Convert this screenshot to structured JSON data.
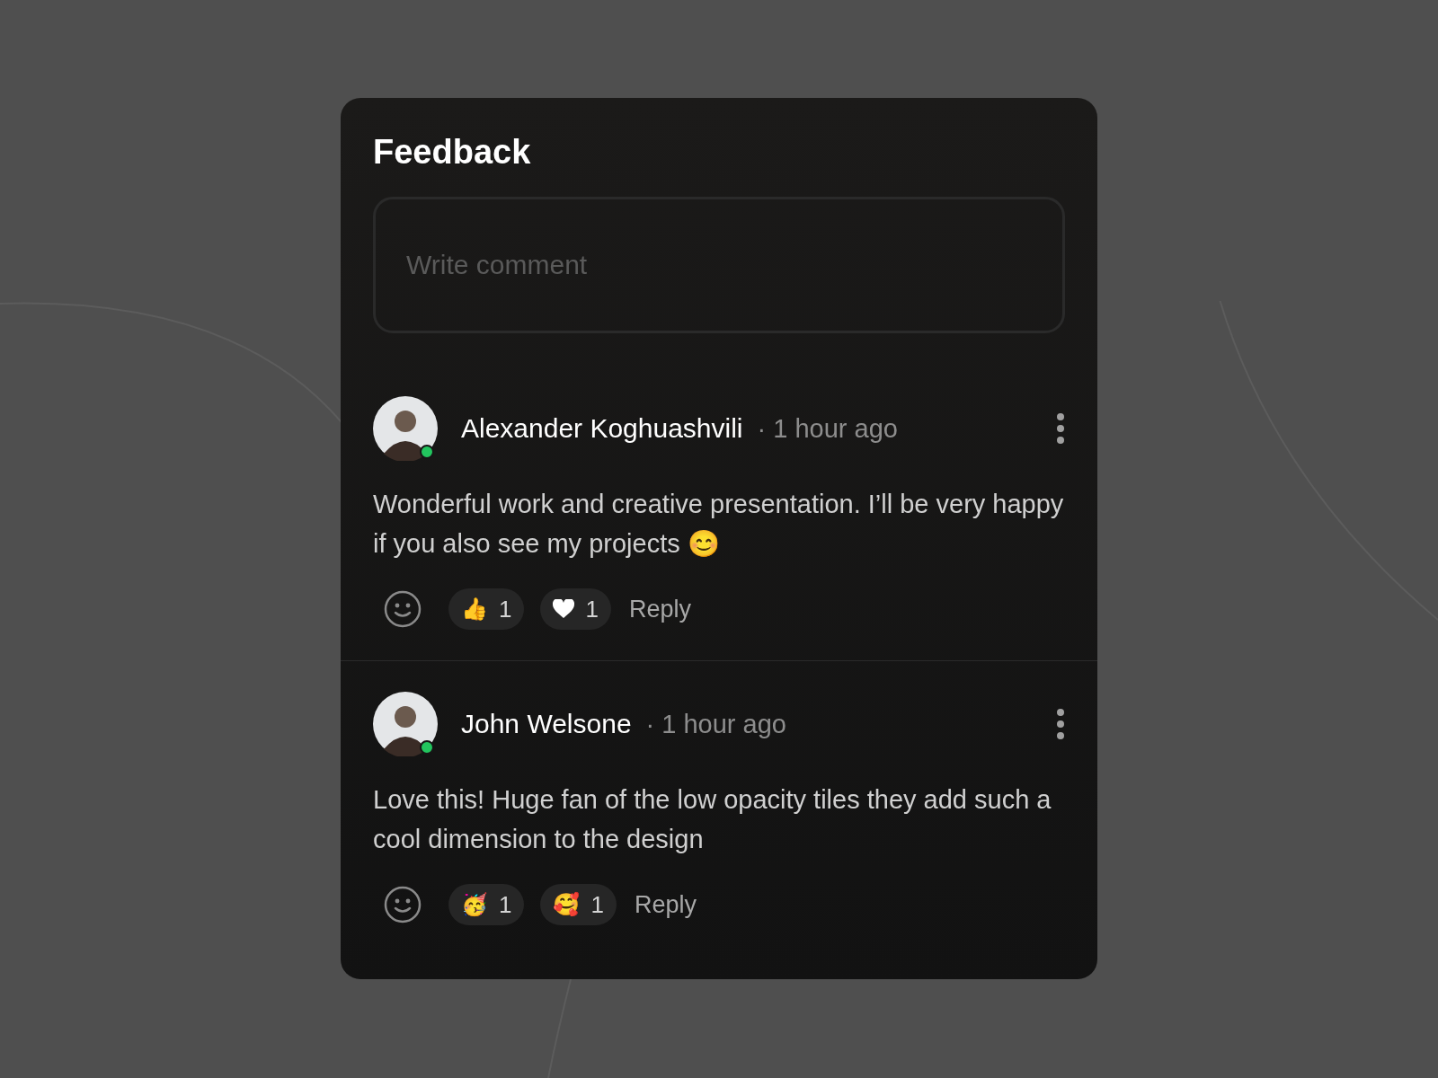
{
  "title": "Feedback",
  "comment_field": {
    "placeholder": "Write comment"
  },
  "comments": [
    {
      "author": "Alexander Koghuashvili",
      "online": true,
      "time": "· 1 hour ago",
      "text": "Wonderful work and creative presentation. I’ll be very happy if you also see my projects 😊",
      "reactions": [
        {
          "kind": "emoji",
          "emoji": "👍",
          "count": "1"
        },
        {
          "kind": "heart",
          "count": "1"
        }
      ],
      "reply": "Reply"
    },
    {
      "author": "John Welsone",
      "online": true,
      "time": "· 1 hour ago",
      "text": "Love this! Huge fan of the low opacity tiles they add such a cool dimension to the design",
      "reactions": [
        {
          "kind": "emoji",
          "emoji": "🥳",
          "count": "1"
        },
        {
          "kind": "emoji",
          "emoji": "🥰",
          "count": "1"
        }
      ],
      "reply": "Reply"
    }
  ]
}
